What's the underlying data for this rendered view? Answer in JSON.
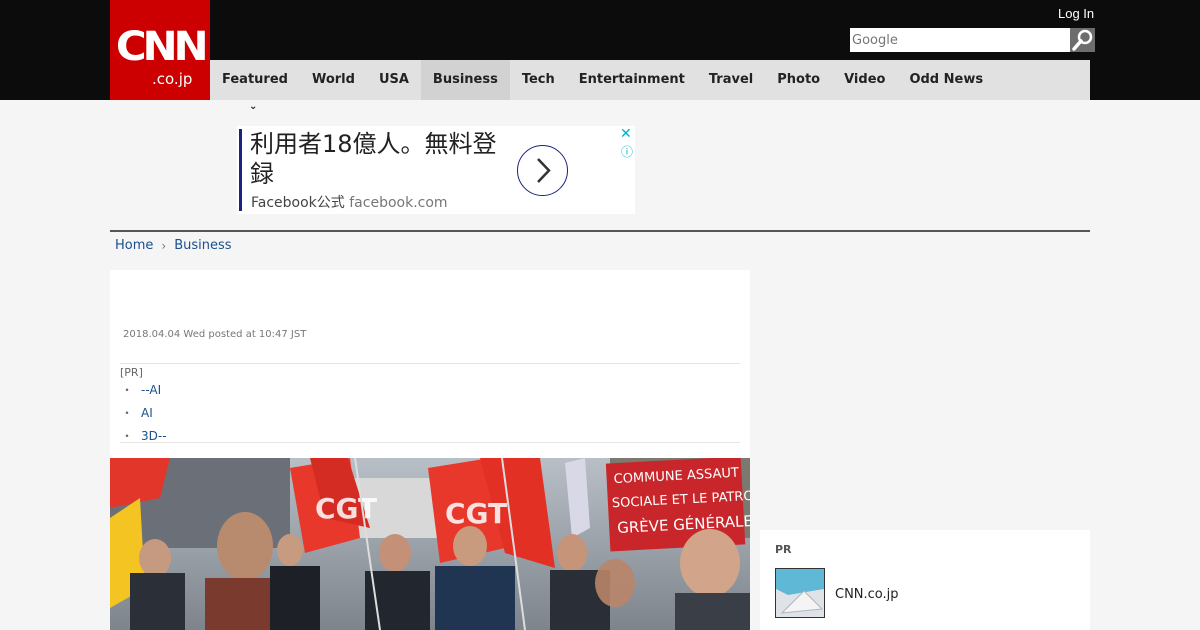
{
  "header": {
    "logo_main": "CNN",
    "logo_sub": ".co.jp",
    "login_label": "Log In",
    "search_placeholder": "Google"
  },
  "nav": {
    "items": [
      {
        "label": "Featured"
      },
      {
        "label": "World"
      },
      {
        "label": "USA"
      },
      {
        "label": "Business"
      },
      {
        "label": "Tech"
      },
      {
        "label": "Entertainment"
      },
      {
        "label": "Travel"
      },
      {
        "label": "Photo"
      },
      {
        "label": "Video"
      },
      {
        "label": "Odd News"
      }
    ],
    "active": "Business",
    "featured_chevron": "⌄"
  },
  "ad": {
    "headline": "利用者18億人。無料登録",
    "source_name": "Facebook公式",
    "source_domain": "facebook.com",
    "close_glyph": "✕",
    "info_glyph": "ⓘ"
  },
  "breadcrumb": {
    "home": "Home",
    "separator": "›",
    "section": "Business"
  },
  "article": {
    "date": "2018.04.04 Wed posted at 10:47 JST"
  },
  "pr_links": {
    "label": "[PR]",
    "bullet": "・",
    "items": [
      "--AI",
      "AI",
      "3D--"
    ]
  },
  "sidebar_pr": {
    "label": "PR",
    "site": "CNN.co.jp"
  },
  "colors": {
    "brand_red": "#cc0000",
    "topbar": "#0c0c0c",
    "nav_bg": "#e1e1e1",
    "link": "#1c4f8c",
    "ad_accent": "#1a237e",
    "ad_icon": "#00aecd"
  },
  "icons": {
    "search": "magnifier-icon",
    "ad_next": "chevron-right-icon"
  }
}
